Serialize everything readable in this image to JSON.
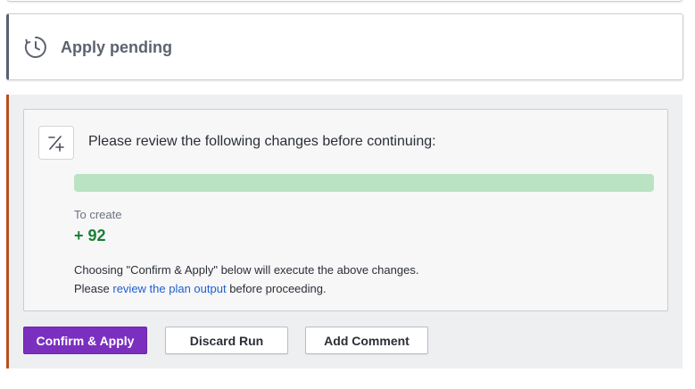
{
  "pending": {
    "title": "Apply pending",
    "icon": "clock-icon"
  },
  "review": {
    "icon": "diff-plus-minus-icon",
    "heading": "Please review the following changes before continuing:",
    "progress_fraction": 1.0,
    "progress_color": "#b9e3c3",
    "create_label": "To create",
    "create_count": "+ 92",
    "note_line1": "Choosing \"Confirm & Apply\" below will execute the above changes.",
    "note_line2_prefix": "Please ",
    "note_link": "review the plan output",
    "note_line2_suffix": " before proceeding."
  },
  "actions": {
    "confirm_label": "Confirm & Apply",
    "discard_label": "Discard Run",
    "comment_label": "Add Comment"
  },
  "colors": {
    "accent_purple": "#7b2fbf",
    "section_border": "#b8501e",
    "create_green": "#1a7f37",
    "link_blue": "#1e5fcf"
  }
}
